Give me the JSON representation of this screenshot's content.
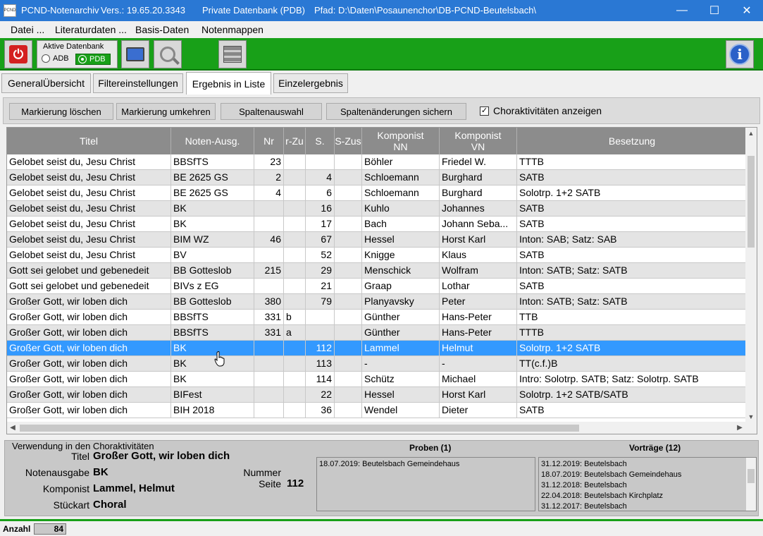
{
  "titlebar": {
    "app_icon_text": "PCND",
    "app_name": "PCND-Notenarchiv",
    "version": "Vers.: 19.65.20.3343",
    "database": "Private Datenbank (PDB)",
    "path": "Pfad: D:\\Daten\\Posaunenchor\\DB-PCND-Beutelsbach\\",
    "minimize": "—",
    "maximize": "☐",
    "close": "✕"
  },
  "menu": [
    "Datei ...",
    "Literaturdaten ...",
    "Basis-Daten",
    "Notenmappen"
  ],
  "toolbar": {
    "db_group_label": "Aktive Datenbank",
    "adb_label": "ADB",
    "pdb_label": "PDB",
    "power_icon": "⏻",
    "info_icon": "i"
  },
  "tabs": [
    "GeneralÜbersicht",
    "Filtereinstellungen",
    "Ergebnis in Liste",
    "Einzelergebnis"
  ],
  "actions": {
    "mark_delete": "Markierung löschen",
    "mark_invert": "Markierung umkehren",
    "column_select": "Spaltenauswahl",
    "column_save": "Spaltenänderungen sichern",
    "show_choir": "Choraktivitäten anzeigen",
    "checkbox_mark": "✓"
  },
  "grid": {
    "headers": [
      "Titel",
      "Noten-Ausg.",
      "Nr",
      "r-Zu",
      "S.",
      "S-Zus",
      "Komponist\nNN",
      "Komponist\nVN",
      "Besetzung"
    ],
    "rows": [
      [
        "Gelobet seist du, Jesu Christ",
        "BBSfTS",
        "23",
        "",
        "",
        "",
        "Böhler",
        "Friedel W.",
        "TTTB"
      ],
      [
        "Gelobet seist du, Jesu Christ",
        "BE 2625 GS",
        "2",
        "",
        "4",
        "",
        "Schloemann",
        "Burghard",
        "SATB"
      ],
      [
        "Gelobet seist du, Jesu Christ",
        "BE 2625 GS",
        "4",
        "",
        "6",
        "",
        "Schloemann",
        "Burghard",
        "Solotrp. 1+2 SATB"
      ],
      [
        "Gelobet seist du, Jesu Christ",
        "BK",
        "",
        "",
        "16",
        "",
        "Kuhlo",
        "Johannes",
        "SATB"
      ],
      [
        "Gelobet seist du, Jesu Christ",
        "BK",
        "",
        "",
        "17",
        "",
        "Bach",
        "Johann Seba...",
        "SATB"
      ],
      [
        "Gelobet seist du, Jesu Christ",
        "BIM WZ",
        "46",
        "",
        "67",
        "",
        "Hessel",
        "Horst Karl",
        "Inton: SAB; Satz: SAB"
      ],
      [
        "Gelobet seist du, Jesu Christ",
        "BV",
        "",
        "",
        "52",
        "",
        "Knigge",
        "Klaus",
        "SATB"
      ],
      [
        "Gott sei gelobet und gebenedeit",
        "BB Gotteslob",
        "215",
        "",
        "29",
        "",
        "Menschick",
        "Wolfram",
        "Inton: SATB; Satz: SATB"
      ],
      [
        "Gott sei gelobet und gebenedeit",
        "BIVs z EG",
        "",
        "",
        "21",
        "",
        "Graap",
        "Lothar",
        "SATB"
      ],
      [
        "Großer Gott, wir loben dich",
        "BB Gotteslob",
        "380",
        "",
        "79",
        "",
        "Planyavsky",
        "Peter",
        "Inton: SATB; Satz: SATB"
      ],
      [
        "Großer Gott, wir loben dich",
        "BBSfTS",
        "331",
        "b",
        "",
        "",
        "Günther",
        "Hans-Peter",
        "TTB"
      ],
      [
        "Großer Gott, wir loben dich",
        "BBSfTS",
        "331",
        "a",
        "",
        "",
        "Günther",
        "Hans-Peter",
        "TTTB"
      ],
      [
        "Großer Gott, wir loben dich",
        "BK",
        "",
        "",
        "112",
        "",
        "Lammel",
        "Helmut",
        "Solotrp. 1+2 SATB"
      ],
      [
        "Großer Gott, wir loben dich",
        "BK",
        "",
        "",
        "113",
        "",
        "-",
        "-",
        "TT(c.f.)B"
      ],
      [
        "Großer Gott, wir loben dich",
        "BK",
        "",
        "",
        "114",
        "",
        "Schütz",
        "Michael",
        "Intro: Solotrp. SATB; Satz: Solotrp. SATB"
      ],
      [
        "Großer Gott, wir loben dich",
        "BIFest",
        "",
        "",
        "22",
        "",
        "Hessel",
        "Horst Karl",
        "Solotrp. 1+2 SATB/SATB"
      ],
      [
        "Großer Gott, wir loben dich",
        "BIH 2018",
        "",
        "",
        "36",
        "",
        "Wendel",
        "Dieter",
        "SATB"
      ]
    ],
    "selected_row": 12
  },
  "detail": {
    "panel_title": "Verwendung in den Choraktivitäten",
    "titel_label": "Titel",
    "titel_value": "Großer Gott, wir loben dich",
    "ausgabe_label": "Notenausgabe",
    "ausgabe_value": "BK",
    "komponist_label": "Komponist",
    "komponist_value": "Lammel, Helmut",
    "stueckart_label": "Stückart",
    "stueckart_value": "Choral",
    "nummer_label": "Nummer",
    "seite_label": "Seite",
    "seite_value": "112",
    "proben_head": "Proben  (1)",
    "proben": [
      "18.07.2019: Beutelsbach Gemeindehaus"
    ],
    "vortraege_head": "Vorträge  (12)",
    "vortraege": [
      "31.12.2019: Beutelsbach",
      "18.07.2019: Beutelsbach Gemeindehaus",
      "31.12.2018: Beutelsbach",
      "22.04.2018: Beutelsbach Kirchplatz",
      "31.12.2017: Beutelsbach"
    ]
  },
  "status": {
    "count_label": "Anzahl",
    "count_value": "84"
  },
  "colors": {
    "titlebar": "#2a78d4",
    "toolbar_green": "#18a018",
    "selection": "#3399ff"
  }
}
